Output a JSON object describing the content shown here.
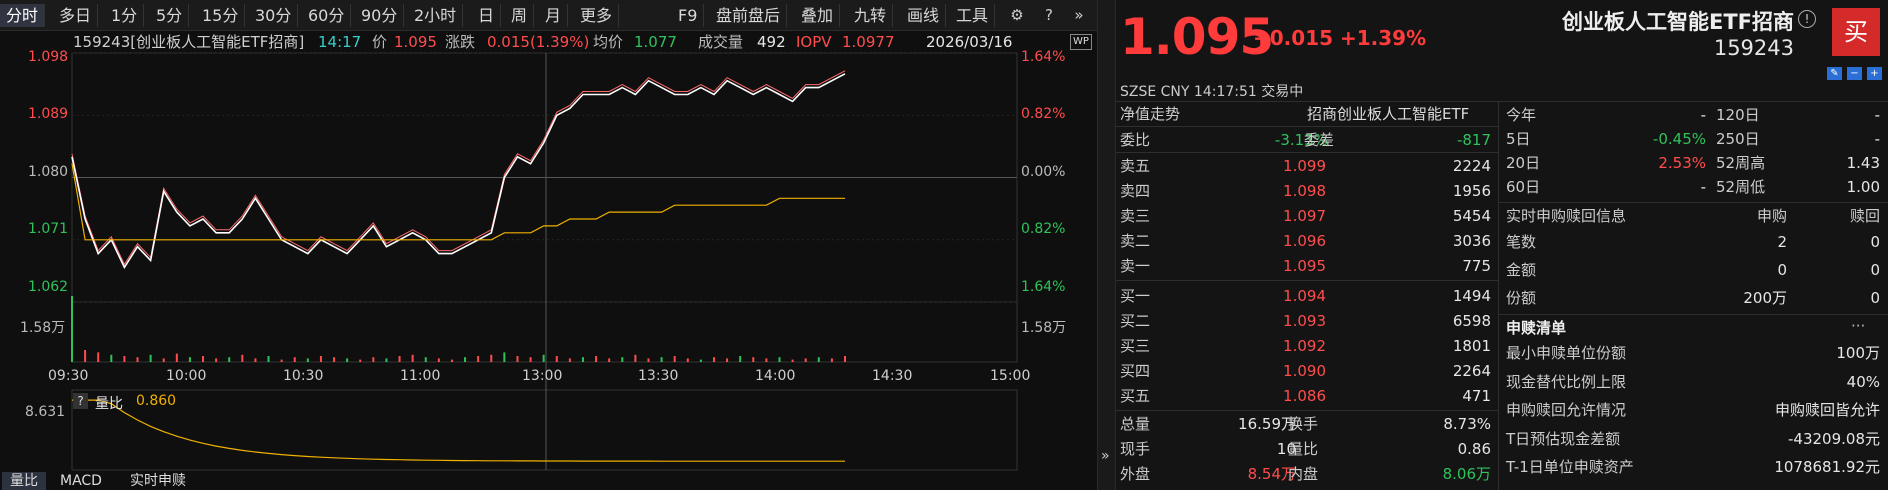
{
  "toolbar": {
    "periods": [
      "分时",
      "多日",
      "1分",
      "5分",
      "15分",
      "30分",
      "60分",
      "90分",
      "2小时",
      "日",
      "周",
      "月",
      "更多"
    ],
    "tools": [
      "F9",
      "盘前盘后",
      "叠加",
      "九转",
      "画线",
      "工具"
    ]
  },
  "info": {
    "code_name": "159243[创业板人工智能ETF招商]",
    "time": "14:17",
    "price_label": "价",
    "price": "1.095",
    "change_label": "涨跌",
    "change": "0.015(1.39%)",
    "avg_label": "均价",
    "avg": "1.077",
    "volume_label": "成交量",
    "volume": "492",
    "iopv_label": "IOPV",
    "iopv": "1.0977",
    "date": "2026/03/16",
    "wp_badge": "WP"
  },
  "chart": {
    "price_ticks": [
      "1.098",
      "1.089",
      "1.080",
      "1.071",
      "1.062"
    ],
    "pct_ticks": [
      "1.64%",
      "0.82%",
      "0.00%",
      "0.82%",
      "1.64%"
    ],
    "vol_tick": "1.58万",
    "time_ticks": [
      "09:30",
      "10:00",
      "10:30",
      "11:00",
      "13:00",
      "13:30",
      "14:00",
      "14:30",
      "15:00"
    ],
    "ratio_label": "量比",
    "ratio_value": "0.860",
    "ratio_tick": "8.631",
    "bottom_tabs": [
      "量比",
      "MACD",
      "实时申赎"
    ]
  },
  "chart_data": {
    "type": "line",
    "series": [
      {
        "values": [
          1.083,
          1.074,
          1.069,
          1.071,
          1.067,
          1.07,
          1.068,
          1.078,
          1.075,
          1.073,
          1.074,
          1.072,
          1.072,
          1.074,
          1.077,
          1.074,
          1.071,
          1.07,
          1.069,
          1.071,
          1.07,
          1.069,
          1.071,
          1.073,
          1.07,
          1.071,
          1.072,
          1.071,
          1.069,
          1.069,
          1.07,
          1.071,
          1.072,
          1.08,
          1.083,
          1.082,
          1.085,
          1.089,
          1.09,
          1.092,
          1.092,
          1.092,
          1.093,
          1.092,
          1.094,
          1.093,
          1.092,
          1.092,
          1.093,
          1.092,
          1.094,
          1.093,
          1.092,
          1.093,
          1.092,
          1.091,
          1.093,
          1.093,
          1.094,
          1.095
        ]
      },
      {
        "values": [
          1.082,
          1.071,
          1.071,
          1.071,
          1.071,
          1.071,
          1.071,
          1.071,
          1.071,
          1.071,
          1.071,
          1.071,
          1.071,
          1.071,
          1.071,
          1.071,
          1.071,
          1.071,
          1.071,
          1.071,
          1.071,
          1.071,
          1.071,
          1.071,
          1.071,
          1.071,
          1.071,
          1.071,
          1.071,
          1.071,
          1.071,
          1.071,
          1.071,
          1.072,
          1.072,
          1.072,
          1.073,
          1.073,
          1.074,
          1.074,
          1.074,
          1.075,
          1.075,
          1.075,
          1.075,
          1.075,
          1.076,
          1.076,
          1.076,
          1.076,
          1.076,
          1.076,
          1.076,
          1.076,
          1.077,
          1.077,
          1.077,
          1.077,
          1.077,
          1.077
        ]
      }
    ],
    "ylim": [
      1.062,
      1.098
    ],
    "yticks": [
      1.098,
      1.089,
      1.08,
      1.071,
      1.062
    ]
  },
  "quote": {
    "price": "1.095",
    "change": "+0.015 +1.39%",
    "name": "创业板人工智能ETF招商",
    "code": "159243",
    "buy_label": "买",
    "help_label": "!",
    "exchange_line": "SZSE  CNY  14:17:51  交易中",
    "nav_label": "净值走势",
    "nav_name": "招商创业板人工智能ETF",
    "weibi_label": "委比",
    "weibi": "-3.13%",
    "weicha_label": "委差",
    "weicha": "-817",
    "asks": [
      {
        "label": "卖五",
        "price": "1.099",
        "vol": "2224"
      },
      {
        "label": "卖四",
        "price": "1.098",
        "vol": "1956"
      },
      {
        "label": "卖三",
        "price": "1.097",
        "vol": "5454"
      },
      {
        "label": "卖二",
        "price": "1.096",
        "vol": "3036"
      },
      {
        "label": "卖一",
        "price": "1.095",
        "vol": "775"
      }
    ],
    "bids": [
      {
        "label": "买一",
        "price": "1.094",
        "vol": "1494"
      },
      {
        "label": "买二",
        "price": "1.093",
        "vol": "6598"
      },
      {
        "label": "买三",
        "price": "1.092",
        "vol": "1801"
      },
      {
        "label": "买四",
        "price": "1.090",
        "vol": "2264"
      },
      {
        "label": "买五",
        "price": "1.086",
        "vol": "471"
      }
    ],
    "stats": [
      {
        "l1": "总量",
        "v1": "16.59万",
        "l2": "换手",
        "v2": "8.73%"
      },
      {
        "l1": "现手",
        "v1": "10",
        "l2": "量比",
        "v2": "0.86"
      },
      {
        "l1": "外盘",
        "v1": "8.54万",
        "l2": "内盘",
        "v2": "8.06万"
      }
    ]
  },
  "periods_panel": [
    {
      "l1": "今年",
      "v1": "-",
      "l2": "120日",
      "v2": "-"
    },
    {
      "l1": "5日",
      "v1": "-0.45%",
      "l2": "250日",
      "v2": "-"
    },
    {
      "l1": "20日",
      "v1": "2.53%",
      "l2": "52周高",
      "v2": "1.43"
    },
    {
      "l1": "60日",
      "v1": "-",
      "l2": "52周低",
      "v2": "1.00"
    }
  ],
  "realtime": {
    "title": "实时申购赎回信息",
    "col1": "申购",
    "col2": "赎回",
    "rows": [
      {
        "label": "笔数",
        "a": "2",
        "b": "0"
      },
      {
        "label": "金额",
        "a": "0",
        "b": "0"
      },
      {
        "label": "份额",
        "a": "200万",
        "b": "0"
      }
    ]
  },
  "redemption": {
    "title": "申赎清单",
    "more": "···",
    "rows": [
      {
        "label": "最小申赎单位份额",
        "value": "100万"
      },
      {
        "label": "现金替代比例上限",
        "value": "40%"
      },
      {
        "label": "申购赎回允许情况",
        "value": "申购赎回皆允许"
      },
      {
        "label": "T日预估现金差额",
        "value": "-43209.08元"
      },
      {
        "label": "T-1日单位申赎资产",
        "value": "1078681.92元"
      }
    ]
  },
  "colors": {
    "up": "#ff4d4d",
    "down": "#2fc25b",
    "avg": "#f0b100",
    "bg": "#0f0f0f"
  }
}
